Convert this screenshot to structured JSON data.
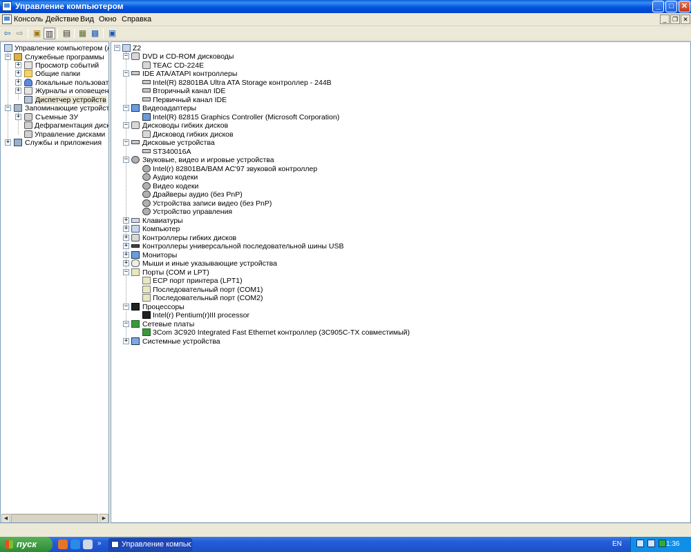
{
  "window": {
    "title": "Управление компьютером",
    "min": "_",
    "max": "□",
    "close": "✕"
  },
  "menu": {
    "items": [
      "Консоль",
      "Действие",
      "Вид",
      "Окно",
      "Справка"
    ],
    "mdi_min": "_",
    "mdi_restore": "❐",
    "mdi_close": "✕"
  },
  "toolbar": {
    "icons": [
      "back-arrow-icon",
      "forward-arrow-icon",
      "up-folder-icon",
      "show-hide-tree-icon",
      "print-icon",
      "properties-icon",
      "help-icon",
      "scan-hardware-icon"
    ]
  },
  "left_tree": {
    "root": "Управление компьютером (локал",
    "system_tools": "Служебные программы",
    "event_viewer": "Просмотр событий",
    "shared_folders": "Общие папки",
    "local_users": "Локальные пользователи",
    "perf_logs": "Журналы и оповещения пр",
    "device_manager": "Диспетчер устройств",
    "storage": "Запоминающие устройства",
    "removable": "Съемные ЗУ",
    "defrag": "Дефрагментация диска",
    "disk_mgmt": "Управление дисками",
    "services_apps": "Службы и приложения"
  },
  "devices": {
    "root": "Z2",
    "dvd": "DVD и CD-ROM дисководы",
    "dvd_1": "TEAC CD-224E",
    "ide": "IDE ATA/ATAPI контроллеры",
    "ide_1": "Intel(R) 82801BA Ultra ATA Storage контроллер - 244B",
    "ide_2": "Вторичный канал IDE",
    "ide_3": "Первичный канал IDE",
    "video": "Видеоадаптеры",
    "video_1": "Intel(R) 82815 Graphics Controller (Microsoft Corporation)",
    "floppy_drives": "Дисководы гибких дисков",
    "floppy_drives_1": "Дисковод гибких дисков",
    "disks": "Дисковые устройства",
    "disks_1": "ST340016A",
    "sound": "Звуковые, видео и игровые устройства",
    "sound_1": "Intel(r) 82801BA/BAM AC'97 звуковой контроллер",
    "sound_2": "Аудио кодеки",
    "sound_3": "Видео кодеки",
    "sound_4": "Драйверы аудио (без PnP)",
    "sound_5": "Устройства записи видео (без PnP)",
    "sound_6": "Устройство управления",
    "keyboards": "Клавиатуры",
    "computer": "Компьютер",
    "floppy_ctrl": "Контроллеры гибких дисков",
    "usb": "Контроллеры универсальной последовательной шины USB",
    "monitors": "Мониторы",
    "mice": "Мыши и иные указывающие устройства",
    "ports": "Порты (COM и LPT)",
    "ports_1": "ECP порт принтера (LPT1)",
    "ports_2": "Последовательный порт (COM1)",
    "ports_3": "Последовательный порт (COM2)",
    "cpu": "Процессоры",
    "cpu_1": "Intel(r) Pentium(r)III processor",
    "net": "Сетевые платы",
    "net_1": "3Com 3C920 Integrated Fast Ethernet контроллер (3C905C-TX совместимый)",
    "system": "Системные устройства"
  },
  "taskbar": {
    "start": "пуск",
    "task_label": "Управление компью...",
    "lang": "EN",
    "clock": "1:36",
    "more": "»"
  }
}
